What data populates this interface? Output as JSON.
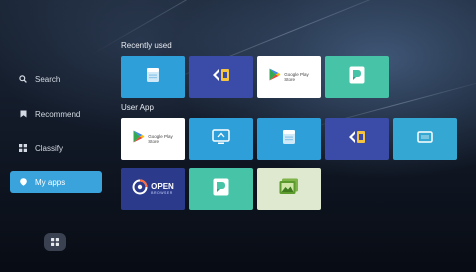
{
  "sidebar": {
    "items": [
      {
        "label": "Search",
        "icon": "search-icon"
      },
      {
        "label": "Recommend",
        "icon": "bookmark-icon"
      },
      {
        "label": "Classify",
        "icon": "grid-icon"
      },
      {
        "label": "My apps",
        "icon": "my-apps-icon",
        "active": true
      }
    ],
    "home_icon": "apps-grid-icon"
  },
  "sections": {
    "recently_used": {
      "title": "Recently used",
      "tiles": [
        {
          "app": "file-manager",
          "color": "#2f9fd9"
        },
        {
          "app": "app-installer",
          "color": "#3b4ba8"
        },
        {
          "app": "Google Play Store",
          "label_line1": "Google Play",
          "label_line2": "Store",
          "color": "#ffffff"
        },
        {
          "app": "document-app",
          "color": "#47c4a7"
        }
      ]
    },
    "user_app": {
      "title": "User App",
      "tiles": [
        {
          "app": "Google Play Store",
          "label_line1": "Google Play",
          "label_line2": "Store",
          "color": "#ffffff"
        },
        {
          "app": "screen-cast",
          "color": "#2f9fd9"
        },
        {
          "app": "file-manager",
          "color": "#2f9fd9"
        },
        {
          "app": "app-installer",
          "color": "#3b4ba8"
        },
        {
          "app": "display-settings",
          "color": "#34a8d2"
        },
        {
          "app": "Open Browser",
          "label_line1": "OPEN",
          "label_line2": "BROWSER",
          "color": "#2c3a8c"
        },
        {
          "app": "document-app",
          "color": "#47c4a7"
        },
        {
          "app": "gallery-app",
          "color": "#dfe9cf"
        }
      ]
    }
  },
  "colors": {
    "accent": "#3aa3dc",
    "background": "#121a28"
  }
}
